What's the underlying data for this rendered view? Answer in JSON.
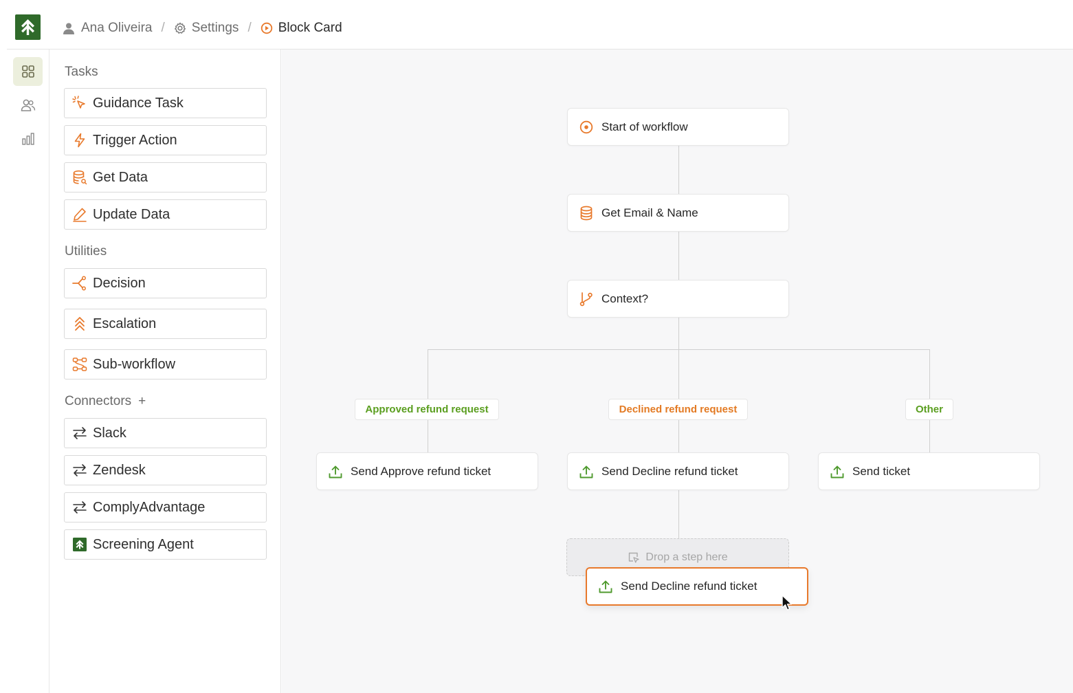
{
  "breadcrumb": {
    "user": "Ana Oliveira",
    "separator": "/",
    "settings": "Settings",
    "current": "Block Card"
  },
  "rail": {
    "items": [
      {
        "icon": "dashboard-grid-icon",
        "active": true
      },
      {
        "icon": "users-icon",
        "active": false
      },
      {
        "icon": "bar-chart-icon",
        "active": false
      }
    ]
  },
  "palette": {
    "tasks_title": "Tasks",
    "tasks": [
      {
        "label": "Guidance Task",
        "icon": "cursor-click-icon"
      },
      {
        "label": "Trigger Action",
        "icon": "lightning-icon"
      },
      {
        "label": "Get Data",
        "icon": "database-icon"
      },
      {
        "label": "Update Data",
        "icon": "pencil-icon"
      }
    ],
    "utilities_title": "Utilities",
    "utilities": [
      {
        "label": "Decision",
        "icon": "decision-branch-icon"
      },
      {
        "label": "Escalation",
        "icon": "escalation-icon"
      },
      {
        "label": "Sub-workflow",
        "icon": "sub-workflow-icon"
      }
    ],
    "connectors_title": "Connectors",
    "connectors_add": "+",
    "connectors": [
      {
        "label": "Slack",
        "icon": "swap-arrows-icon"
      },
      {
        "label": "Zendesk",
        "icon": "swap-arrows-icon"
      },
      {
        "label": "ComplyAdvantage",
        "icon": "swap-arrows-icon"
      },
      {
        "label": "Screening Agent",
        "icon": "screening-agent-logo-icon"
      }
    ]
  },
  "workflow": {
    "start": "Start of workflow",
    "get_data": "Get Email & Name",
    "decision": "Context?",
    "branches": [
      {
        "label": "Approved refund request",
        "color": "#5a9e1f",
        "step": "Send Approve refund ticket"
      },
      {
        "label": "Declined refund request",
        "color": "#e37a23",
        "step": "Send Decline refund ticket"
      },
      {
        "label": "Other",
        "color": "#5a9e1f",
        "step": "Send ticket"
      }
    ],
    "dropzone": "Drop a step here",
    "dragging_step": "Send Decline refund ticket"
  },
  "colors": {
    "accent": "#e8792b",
    "brand": "#2f6a2a",
    "success": "#4f9a2e"
  }
}
